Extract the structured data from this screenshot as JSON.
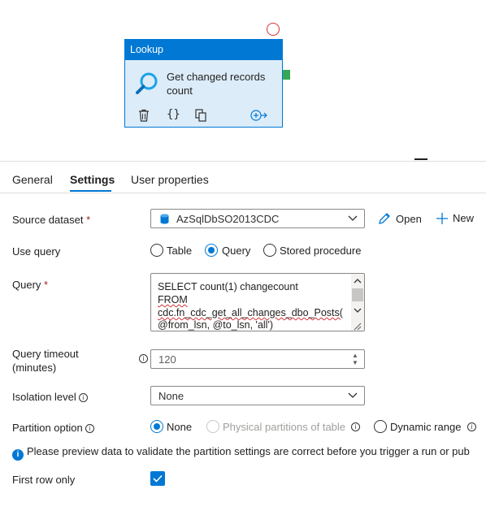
{
  "activity": {
    "type_label": "Lookup",
    "name": "Get changed records count"
  },
  "tabs": [
    {
      "label": "General"
    },
    {
      "label": "Settings"
    },
    {
      "label": "User properties"
    }
  ],
  "active_tab": "Settings",
  "source_dataset": {
    "label": "Source dataset",
    "required_mark": "*",
    "value": "AzSqlDbSO2013CDC",
    "open_label": "Open",
    "new_label": "New"
  },
  "use_query": {
    "label": "Use query",
    "options": [
      "Table",
      "Query",
      "Stored procedure"
    ],
    "selected": "Query"
  },
  "query": {
    "label": "Query",
    "required_mark": "*",
    "lines": [
      "SELECT count(1) changecount",
      "FROM",
      "cdc.fn_cdc_get_all_changes_dbo_Posts(",
      "@from_lsn, @to_lsn, 'all')"
    ]
  },
  "query_timeout": {
    "label_line1": "Query timeout",
    "label_line2": "(minutes)",
    "value": "120"
  },
  "isolation_level": {
    "label": "Isolation level",
    "value": "None"
  },
  "partition_option": {
    "label": "Partition option",
    "options": [
      "None",
      "Physical partitions of table",
      "Dynamic range"
    ],
    "selected": "None"
  },
  "notice": "Please preview data to validate the partition settings are correct before you trigger a run or pub",
  "first_row_only": {
    "label": "First row only",
    "checked": true
  },
  "colors": {
    "accent": "#0078d4",
    "error": "#d13438",
    "success": "#36a854"
  }
}
